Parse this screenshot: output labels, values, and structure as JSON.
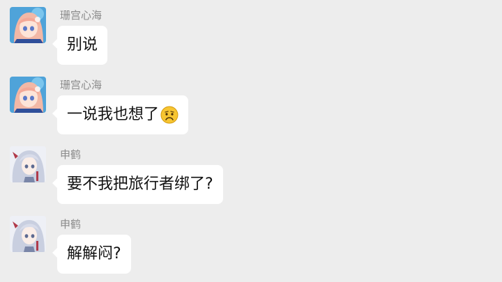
{
  "messages": [
    {
      "sender": "珊宫心海",
      "avatar": "kokomi-avatar",
      "text": "别说",
      "emoji": ""
    },
    {
      "sender": "珊宫心海",
      "avatar": "kokomi-avatar",
      "text": "一说我也想了",
      "emoji": "sad-emoji"
    },
    {
      "sender": "申鹤",
      "avatar": "shenhe-avatar",
      "text": "要不我把旅行者绑了?",
      "emoji": ""
    },
    {
      "sender": "申鹤",
      "avatar": "shenhe-avatar",
      "text": "解解闷?",
      "emoji": ""
    }
  ],
  "colors": {
    "background": "#ededed",
    "bubble": "#ffffff",
    "sender_name": "#8a8a8a",
    "text": "#111111"
  }
}
